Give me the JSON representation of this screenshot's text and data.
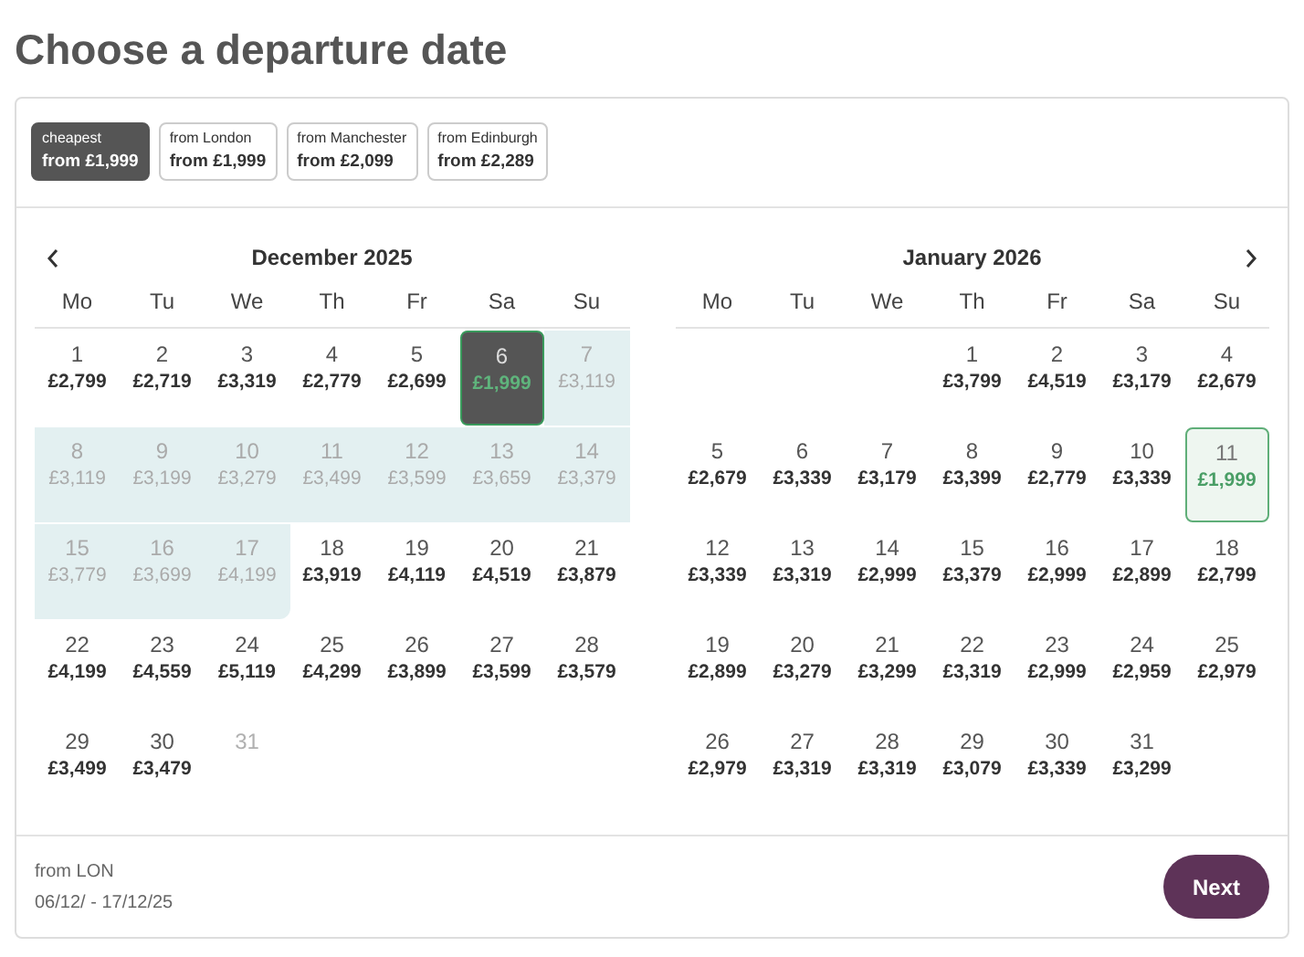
{
  "title": "Choose a departure date",
  "filters": [
    {
      "label": "cheapest",
      "price": "from £1,999",
      "selected": true
    },
    {
      "label": "from London",
      "price": "from £1,999",
      "selected": false
    },
    {
      "label": "from Manchester",
      "price": "from £2,099",
      "selected": false
    },
    {
      "label": "from Edinburgh",
      "price": "from £2,289",
      "selected": false
    }
  ],
  "months": [
    {
      "title": "December 2025",
      "weekdays": [
        "Mo",
        "Tu",
        "We",
        "Th",
        "Fr",
        "Sa",
        "Su"
      ],
      "weeks": [
        [
          {
            "kind": "normal",
            "day": "1",
            "price": "£2,799"
          },
          {
            "kind": "normal",
            "day": "2",
            "price": "£2,719"
          },
          {
            "kind": "normal",
            "day": "3",
            "price": "£3,319"
          },
          {
            "kind": "normal",
            "day": "4",
            "price": "£2,779"
          },
          {
            "kind": "normal",
            "day": "5",
            "price": "£2,699"
          },
          {
            "kind": "start",
            "day": "6",
            "price": "£1,999"
          },
          {
            "kind": "range",
            "day": "7",
            "price": "£3,119"
          }
        ],
        [
          {
            "kind": "range",
            "day": "8",
            "price": "£3,119"
          },
          {
            "kind": "range",
            "day": "9",
            "price": "£3,199"
          },
          {
            "kind": "range",
            "day": "10",
            "price": "£3,279"
          },
          {
            "kind": "range",
            "day": "11",
            "price": "£3,499"
          },
          {
            "kind": "range",
            "day": "12",
            "price": "£3,599"
          },
          {
            "kind": "range",
            "day": "13",
            "price": "£3,659"
          },
          {
            "kind": "range",
            "day": "14",
            "price": "£3,379"
          }
        ],
        [
          {
            "kind": "range",
            "day": "15",
            "price": "£3,779"
          },
          {
            "kind": "range",
            "day": "16",
            "price": "£3,699"
          },
          {
            "kind": "end",
            "day": "17",
            "price": "£4,199"
          },
          {
            "kind": "normal",
            "day": "18",
            "price": "£3,919"
          },
          {
            "kind": "normal",
            "day": "19",
            "price": "£4,119"
          },
          {
            "kind": "normal",
            "day": "20",
            "price": "£4,519"
          },
          {
            "kind": "normal",
            "day": "21",
            "price": "£3,879"
          }
        ],
        [
          {
            "kind": "normal",
            "day": "22",
            "price": "£4,199"
          },
          {
            "kind": "normal",
            "day": "23",
            "price": "£4,559"
          },
          {
            "kind": "normal",
            "day": "24",
            "price": "£5,119"
          },
          {
            "kind": "normal",
            "day": "25",
            "price": "£4,299"
          },
          {
            "kind": "normal",
            "day": "26",
            "price": "£3,899"
          },
          {
            "kind": "normal",
            "day": "27",
            "price": "£3,599"
          },
          {
            "kind": "normal",
            "day": "28",
            "price": "£3,579"
          }
        ],
        [
          {
            "kind": "normal",
            "day": "29",
            "price": "£3,499"
          },
          {
            "kind": "normal",
            "day": "30",
            "price": "£3,479"
          },
          {
            "kind": "unavailable",
            "day": "31"
          },
          {
            "kind": "blank"
          },
          {
            "kind": "blank"
          },
          {
            "kind": "blank"
          },
          {
            "kind": "blank"
          }
        ]
      ]
    },
    {
      "title": "January 2026",
      "weekdays": [
        "Mo",
        "Tu",
        "We",
        "Th",
        "Fr",
        "Sa",
        "Su"
      ],
      "weeks": [
        [
          {
            "kind": "blank"
          },
          {
            "kind": "blank"
          },
          {
            "kind": "blank"
          },
          {
            "kind": "normal",
            "day": "1",
            "price": "£3,799"
          },
          {
            "kind": "normal",
            "day": "2",
            "price": "£4,519"
          },
          {
            "kind": "normal",
            "day": "3",
            "price": "£3,179"
          },
          {
            "kind": "normal",
            "day": "4",
            "price": "£2,679"
          }
        ],
        [
          {
            "kind": "normal",
            "day": "5",
            "price": "£2,679"
          },
          {
            "kind": "normal",
            "day": "6",
            "price": "£3,339"
          },
          {
            "kind": "normal",
            "day": "7",
            "price": "£3,179"
          },
          {
            "kind": "normal",
            "day": "8",
            "price": "£3,399"
          },
          {
            "kind": "normal",
            "day": "9",
            "price": "£2,779"
          },
          {
            "kind": "normal",
            "day": "10",
            "price": "£3,339"
          },
          {
            "kind": "cheapest",
            "day": "11",
            "price": "£1,999"
          }
        ],
        [
          {
            "kind": "normal",
            "day": "12",
            "price": "£3,339"
          },
          {
            "kind": "normal",
            "day": "13",
            "price": "£3,319"
          },
          {
            "kind": "normal",
            "day": "14",
            "price": "£2,999"
          },
          {
            "kind": "normal",
            "day": "15",
            "price": "£3,379"
          },
          {
            "kind": "normal",
            "day": "16",
            "price": "£2,999"
          },
          {
            "kind": "normal",
            "day": "17",
            "price": "£2,899"
          },
          {
            "kind": "normal",
            "day": "18",
            "price": "£2,799"
          }
        ],
        [
          {
            "kind": "normal",
            "day": "19",
            "price": "£2,899"
          },
          {
            "kind": "normal",
            "day": "20",
            "price": "£3,279"
          },
          {
            "kind": "normal",
            "day": "21",
            "price": "£3,299"
          },
          {
            "kind": "normal",
            "day": "22",
            "price": "£3,319"
          },
          {
            "kind": "normal",
            "day": "23",
            "price": "£2,999"
          },
          {
            "kind": "normal",
            "day": "24",
            "price": "£2,959"
          },
          {
            "kind": "normal",
            "day": "25",
            "price": "£2,979"
          }
        ],
        [
          {
            "kind": "normal",
            "day": "26",
            "price": "£2,979"
          },
          {
            "kind": "normal",
            "day": "27",
            "price": "£3,319"
          },
          {
            "kind": "normal",
            "day": "28",
            "price": "£3,319"
          },
          {
            "kind": "normal",
            "day": "29",
            "price": "£3,079"
          },
          {
            "kind": "normal",
            "day": "30",
            "price": "£3,339"
          },
          {
            "kind": "normal",
            "day": "31",
            "price": "£3,299"
          },
          {
            "kind": "blank"
          }
        ]
      ]
    }
  ],
  "footer": {
    "origin": "from LON",
    "dates": "06/12/ - 17/12/25",
    "button": "Next"
  }
}
